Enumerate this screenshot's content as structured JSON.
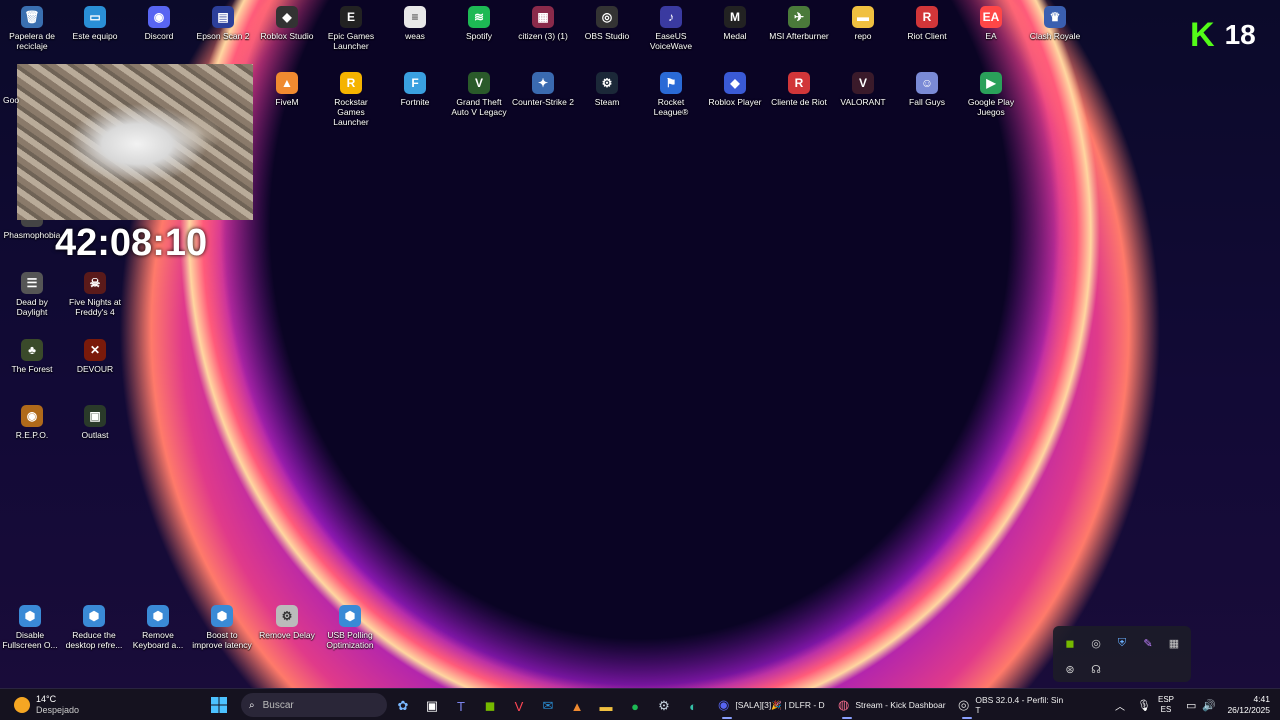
{
  "desktop_icons": [
    {
      "label": "Papelera de reciclaje",
      "icon": "recycle-bin-icon",
      "glyph": "🗑",
      "color": "#3a6fb0"
    },
    {
      "label": "Este equipo",
      "icon": "computer-icon",
      "glyph": "▭",
      "color": "#2a8fd6"
    },
    {
      "label": "Discord",
      "icon": "discord-icon",
      "glyph": "◉",
      "color": "#5865f2"
    },
    {
      "label": "Epson Scan 2",
      "icon": "scanner-icon",
      "glyph": "▤",
      "color": "#2c3f9a"
    },
    {
      "label": "Roblox Studio",
      "icon": "roblox-studio-icon",
      "glyph": "◆",
      "color": "#333"
    },
    {
      "label": "Epic Games Launcher",
      "icon": "epic-games-icon",
      "glyph": "E",
      "color": "#222"
    },
    {
      "label": "weas",
      "icon": "text-file-icon",
      "glyph": "≡",
      "color": "#e8e8e8"
    },
    {
      "label": "Spotify",
      "icon": "spotify-icon",
      "glyph": "≋",
      "color": "#1db954"
    },
    {
      "label": "citizen (3) (1)",
      "icon": "winrar-archive-icon",
      "glyph": "▦",
      "color": "#8a2a4a"
    },
    {
      "label": "OBS Studio",
      "icon": "obs-icon",
      "glyph": "◎",
      "color": "#333"
    },
    {
      "label": "EaseUS VoiceWave",
      "icon": "voicewave-icon",
      "glyph": "♪",
      "color": "#3a3aa0"
    },
    {
      "label": "Medal",
      "icon": "medal-icon",
      "glyph": "M",
      "color": "#222"
    },
    {
      "label": "MSI Afterburner",
      "icon": "afterburner-icon",
      "glyph": "✈",
      "color": "#4a7a3a"
    },
    {
      "label": "repo",
      "icon": "folder-icon",
      "glyph": "▬",
      "color": "#f0c040"
    },
    {
      "label": "Riot Client",
      "icon": "riot-client-icon",
      "glyph": "R",
      "color": "#d13639"
    },
    {
      "label": "EA",
      "icon": "ea-icon",
      "glyph": "EA",
      "color": "#ff4747"
    },
    {
      "label": "Clash Royale",
      "icon": "clash-royale-icon",
      "glyph": "♛",
      "color": "#3a5fb0"
    },
    {
      "label": "FiveM",
      "icon": "fivem-icon",
      "glyph": "▲",
      "color": "#f08a30"
    },
    {
      "label": "Rockstar Games Launcher",
      "icon": "rockstar-icon",
      "glyph": "R",
      "color": "#f5b300"
    },
    {
      "label": "Fortnite",
      "icon": "fortnite-icon",
      "glyph": "F",
      "color": "#3aa0e0"
    },
    {
      "label": "Grand Theft Auto V Legacy",
      "icon": "gta-icon",
      "glyph": "V",
      "color": "#2a5a2a"
    },
    {
      "label": "Counter-Strike 2",
      "icon": "cs2-icon",
      "glyph": "✦",
      "color": "#3a6ab0"
    },
    {
      "label": "Steam",
      "icon": "steam-icon",
      "glyph": "⚙",
      "color": "#1b2838"
    },
    {
      "label": "Rocket League®",
      "icon": "rocket-league-icon",
      "glyph": "⚑",
      "color": "#2a6ad6"
    },
    {
      "label": "Roblox Player",
      "icon": "roblox-icon",
      "glyph": "◆",
      "color": "#3a5ad6"
    },
    {
      "label": "Cliente de Riot",
      "icon": "riot-icon",
      "glyph": "R",
      "color": "#d13639"
    },
    {
      "label": "VALORANT",
      "icon": "valorant-icon",
      "glyph": "V",
      "color": "#3a1a2a"
    },
    {
      "label": "Fall Guys",
      "icon": "fall-guys-icon",
      "glyph": "☺",
      "color": "#7a8ad6"
    },
    {
      "label": "Google Play Juegos",
      "icon": "google-play-games-icon",
      "glyph": "▶",
      "color": "#2aa05a"
    },
    {
      "label": "Phasmophobia",
      "icon": "phasmophobia-icon",
      "glyph": "",
      "color": "#444"
    },
    {
      "label": "Dead by Daylight",
      "icon": "dead-by-daylight-icon",
      "glyph": "☰",
      "color": "#555"
    },
    {
      "label": "Five Nights at Freddy's 4",
      "icon": "fnaf-icon",
      "glyph": "☠",
      "color": "#5a1a1a"
    },
    {
      "label": "The Forest",
      "icon": "the-forest-icon",
      "glyph": "♣",
      "color": "#3a4a2a"
    },
    {
      "label": "DEVOUR",
      "icon": "devour-icon",
      "glyph": "✕",
      "color": "#7a1a0a"
    },
    {
      "label": "R.E.P.O.",
      "icon": "repo-game-icon",
      "glyph": "◉",
      "color": "#b06a1a"
    },
    {
      "label": "Outlast",
      "icon": "outlast-icon",
      "glyph": "▣",
      "color": "#2a3a2a"
    },
    {
      "label": "Disable Fullscreen O...",
      "icon": "regedit-file-icon",
      "glyph": "⬢",
      "color": "#3a8ad6"
    },
    {
      "label": "Reduce the desktop refre...",
      "icon": "regedit-file-icon",
      "glyph": "⬢",
      "color": "#3a8ad6"
    },
    {
      "label": "Remove Keyboard a...",
      "icon": "regedit-file-icon",
      "glyph": "⬢",
      "color": "#3a8ad6"
    },
    {
      "label": "Boost to improve latency",
      "icon": "regedit-file-icon",
      "glyph": "⬢",
      "color": "#3a8ad6"
    },
    {
      "label": "Remove Delay",
      "icon": "settings-file-icon",
      "glyph": "⚙",
      "color": "#bbb"
    },
    {
      "label": "USB Polling Optimization",
      "icon": "regedit-file-icon",
      "glyph": "⬢",
      "color": "#3a8ad6"
    }
  ],
  "overlay": {
    "badge_letter": "K",
    "badge_number": "18",
    "timer": "42:08:10",
    "partial_label_left": "Goo"
  },
  "tray_popup_icons": [
    "nvidia-icon",
    "app-icon",
    "defender-icon",
    "feather-icon",
    "keyboard-icon",
    "steelseries-icon",
    "headset-icon"
  ],
  "taskbar": {
    "weather_temp": "14°C",
    "weather_desc": "Despejado",
    "search_placeholder": "Buscar",
    "apps": [
      {
        "label": "[SALA][3]🎉 | DLFR - D",
        "icon": "discord-icon"
      },
      {
        "label": "Stream - Kick Dashboar",
        "icon": "browser-icon"
      },
      {
        "label": "OBS 32.0.4 - Perfil: Sin T",
        "icon": "obs-icon"
      }
    ],
    "lang_top": "ESP",
    "lang_bottom": "ES",
    "time": "4:41",
    "date": "26/12/2025"
  },
  "colors": {
    "kick_green": "#53fc18",
    "taskbar_bg": "#15121f"
  }
}
